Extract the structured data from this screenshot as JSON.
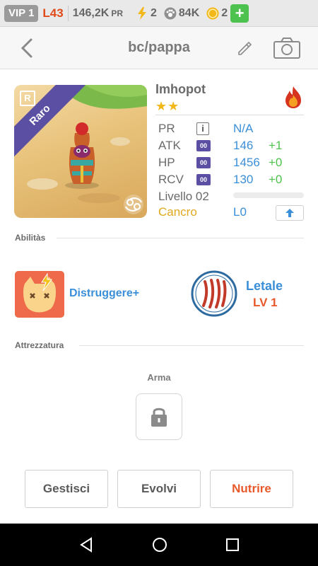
{
  "status": {
    "vip": "VIP 1",
    "level": "L43",
    "pr_value": "146,2K",
    "pr_unit": "PR",
    "energy": "2",
    "paw_points": "84K",
    "coins": "2",
    "add_label": "+"
  },
  "header": {
    "title": "bc/pappa"
  },
  "creature": {
    "rarity_badge": "R",
    "rarity": "Raro",
    "name": "Imhopot",
    "stars": "★★",
    "element_icon": "fire-icon",
    "stats": [
      {
        "label": "PR",
        "value": "N/A",
        "bonus": ""
      },
      {
        "label": "ATK",
        "badge": "00",
        "value": "146",
        "bonus": "+1"
      },
      {
        "label": "HP",
        "badge": "00",
        "value": "1456",
        "bonus": "+0"
      },
      {
        "label": "RCV",
        "badge": "00",
        "value": "130",
        "bonus": "+0"
      }
    ],
    "level_label": "Livello 02",
    "xp_progress": 0,
    "sign": "Cancro",
    "sign_level": "L0"
  },
  "abilities": {
    "section_label": "Abilitàs",
    "items": [
      {
        "name": "Distruggere+",
        "icon": "lightning-cat-icon"
      },
      {
        "name": "Letale",
        "level": "LV 1",
        "icon": "claw-marks-icon"
      }
    ]
  },
  "equipment": {
    "section_label": "Attrezzatura",
    "slot_label": "Arma",
    "slot_icon": "lock-icon"
  },
  "actions": {
    "manage": "Gestisci",
    "evolve": "Evolvi",
    "feed": "Nutrire"
  },
  "colors": {
    "accent_blue": "#3a8fd8",
    "bonus_green": "#4ec24e",
    "highlight_orange": "#e8582a",
    "rarity_purple": "#5b4fa3",
    "sign_gold": "#e0a81e"
  }
}
